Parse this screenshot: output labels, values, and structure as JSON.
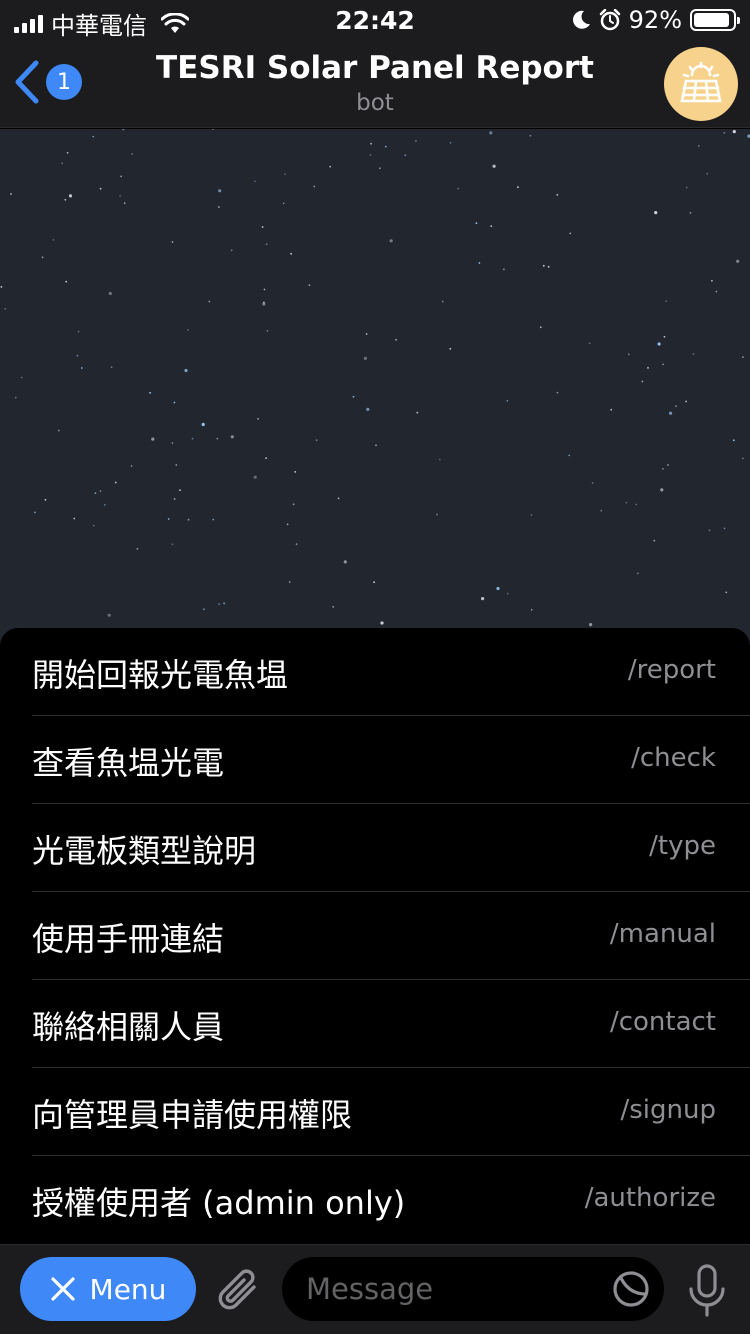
{
  "status_bar": {
    "carrier": "中華電信",
    "time": "22:42",
    "battery_percent": "92%",
    "battery_level": 0.92,
    "icons": [
      "signal-icon",
      "wifi-icon",
      "moon-icon",
      "alarm-icon",
      "battery-icon"
    ]
  },
  "header": {
    "back_count": "1",
    "title": "TESRI Solar Panel Report",
    "subtitle": "bot",
    "avatar_icon": "solar-panel-icon",
    "avatar_color": "#f7d28c"
  },
  "menu": {
    "items": [
      {
        "label": "開始回報光電魚塭",
        "command": "/report"
      },
      {
        "label": "查看魚塭光電",
        "command": "/check"
      },
      {
        "label": "光電板類型說明",
        "command": "/type"
      },
      {
        "label": "使用手冊連結",
        "command": "/manual"
      },
      {
        "label": "聯絡相關人員",
        "command": "/contact"
      },
      {
        "label": "向管理員申請使用權限",
        "command": "/signup"
      },
      {
        "label": "授權使用者 (admin only)",
        "command": "/authorize"
      }
    ]
  },
  "input_bar": {
    "menu_label": "Menu",
    "placeholder": "Message"
  },
  "colors": {
    "accent": "#3e88f7",
    "background": "#000000",
    "bar": "#1c1c1e",
    "secondary_text": "#8e8e93"
  }
}
